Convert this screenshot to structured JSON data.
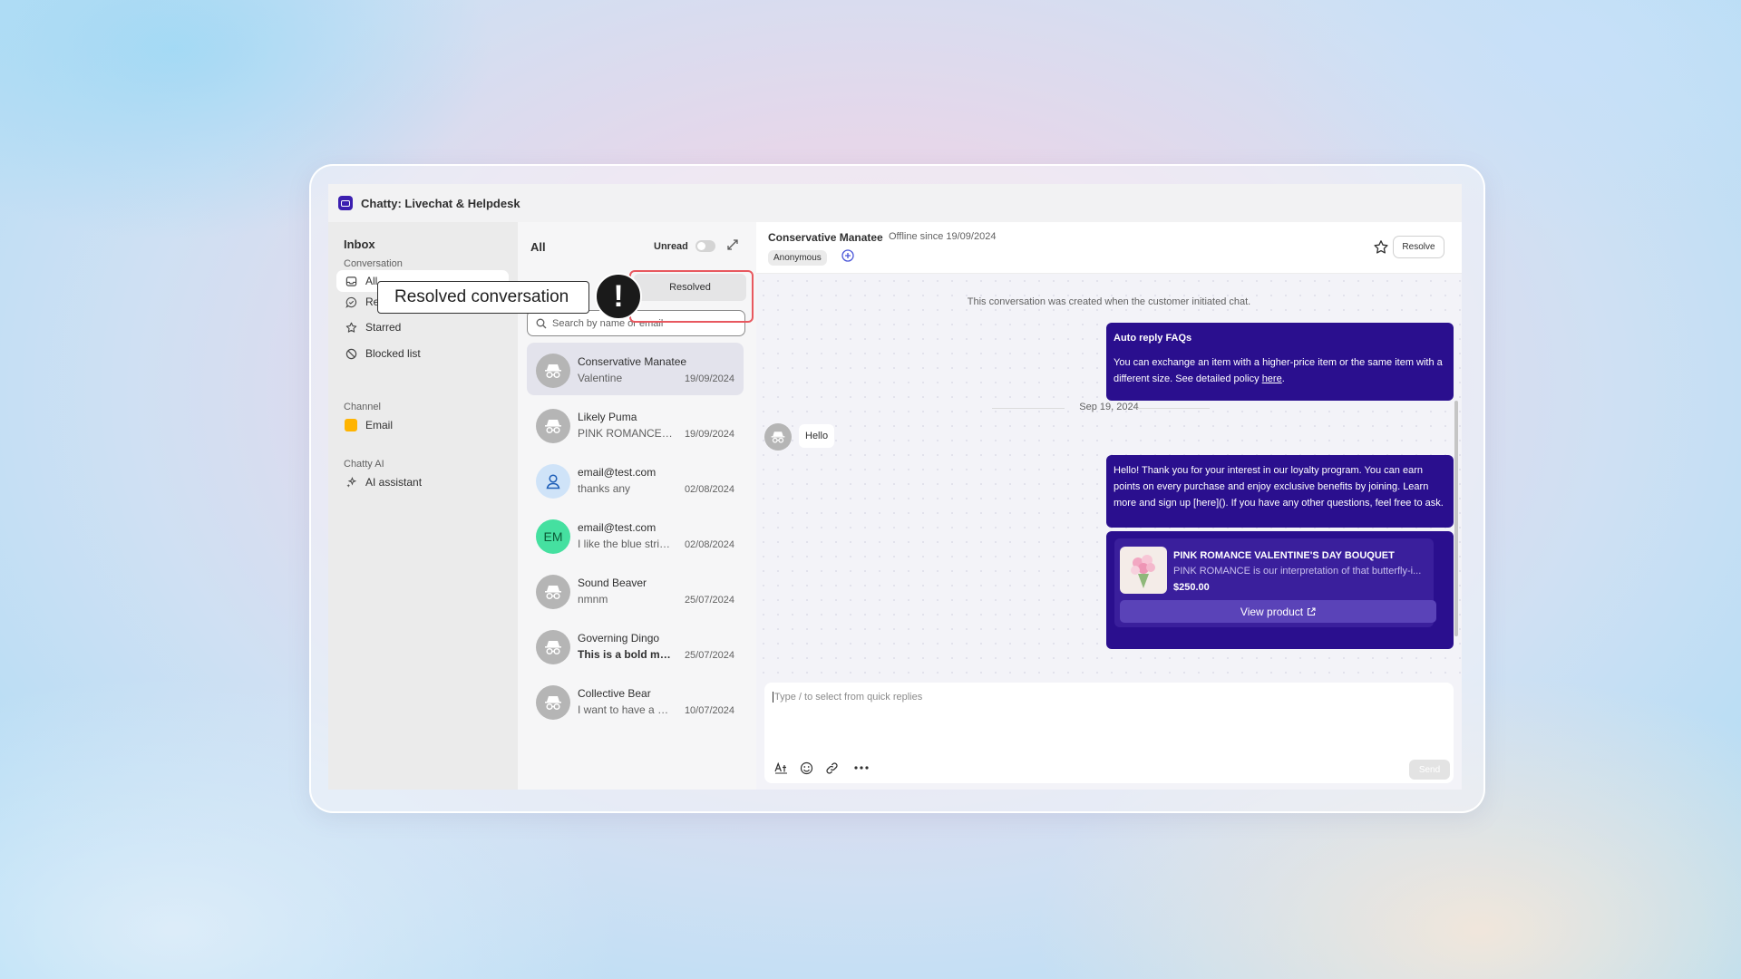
{
  "app": {
    "title": "Chatty: Livechat & Helpdesk"
  },
  "sidebar": {
    "heading": "Inbox",
    "conversation_section": "Conversation",
    "items": [
      {
        "label": "All",
        "icon": "inbox-icon"
      },
      {
        "label": "Resolved",
        "icon": "chat-check-icon"
      },
      {
        "label": "Starred",
        "icon": "star-icon"
      },
      {
        "label": "Blocked list",
        "icon": "block-icon"
      }
    ],
    "channel_section": "Channel",
    "channel_items": [
      {
        "label": "Email",
        "icon": "email-icon"
      }
    ],
    "ai_section": "Chatty AI",
    "ai_items": [
      {
        "label": "AI assistant",
        "icon": "sparkle-icon"
      }
    ]
  },
  "list": {
    "title": "All",
    "unread_label": "Unread",
    "tab_resolved": "Resolved",
    "search_placeholder": "Search by name or email",
    "conversations": [
      {
        "name": "Conservative Manatee",
        "preview": "Valentine",
        "date": "19/09/2024",
        "avatar": "anonymous-icon",
        "selected": true
      },
      {
        "name": "Likely Puma",
        "preview": "PINK ROMANCE V...",
        "date": "19/09/2024",
        "avatar": "anonymous-icon"
      },
      {
        "name": "email@test.com",
        "preview": "thanks any",
        "date": "02/08/2024",
        "avatar": "user-icon"
      },
      {
        "name": "email@test.com",
        "preview": "I like the blue strip...",
        "date": "02/08/2024",
        "avatar_initials": "EM"
      },
      {
        "name": "Sound Beaver",
        "preview": "nmnm",
        "date": "25/07/2024",
        "avatar": "anonymous-icon"
      },
      {
        "name": "Governing Dingo",
        "preview": "This is a bold me...",
        "date": "25/07/2024",
        "avatar": "anonymous-icon",
        "unread": true
      },
      {
        "name": "Collective Bear",
        "preview": "I want to have a bi...",
        "date": "10/07/2024",
        "avatar": "anonymous-icon"
      }
    ]
  },
  "chat": {
    "customer_name": "Conservative Manatee",
    "status": "Offline since 19/09/2024",
    "tag": "Anonymous",
    "resolve_label": "Resolve",
    "system_note": "This conversation was created when the customer initiated chat.",
    "faq_title": "Auto reply FAQs",
    "faq_body": "You can exchange an item with a higher-price item or the same item with a different size. See detailed policy",
    "faq_link": "here",
    "date_separator": "Sep 19, 2024",
    "customer_message": "Hello",
    "agent_message": "Hello! Thank you for your interest in our loyalty program. You can earn points on every purchase and enjoy exclusive benefits by joining. Learn more and sign up [here](). If you have any other questions, feel free to ask.",
    "product": {
      "title": "PINK ROMANCE VALENTINE'S DAY BOUQUET",
      "description": "PINK ROMANCE is our interpretation of that butterfly-i...",
      "price": "$250.00",
      "button_label": "View product"
    },
    "composer_placeholder": "Type / to select from quick replies",
    "send_label": "Send"
  },
  "callout": {
    "text": "Resolved conversation",
    "badge": "!"
  },
  "colors": {
    "accent": "#2a0f8e",
    "highlight": "#e8585f",
    "sidebar_bg": "#ebebeb"
  }
}
